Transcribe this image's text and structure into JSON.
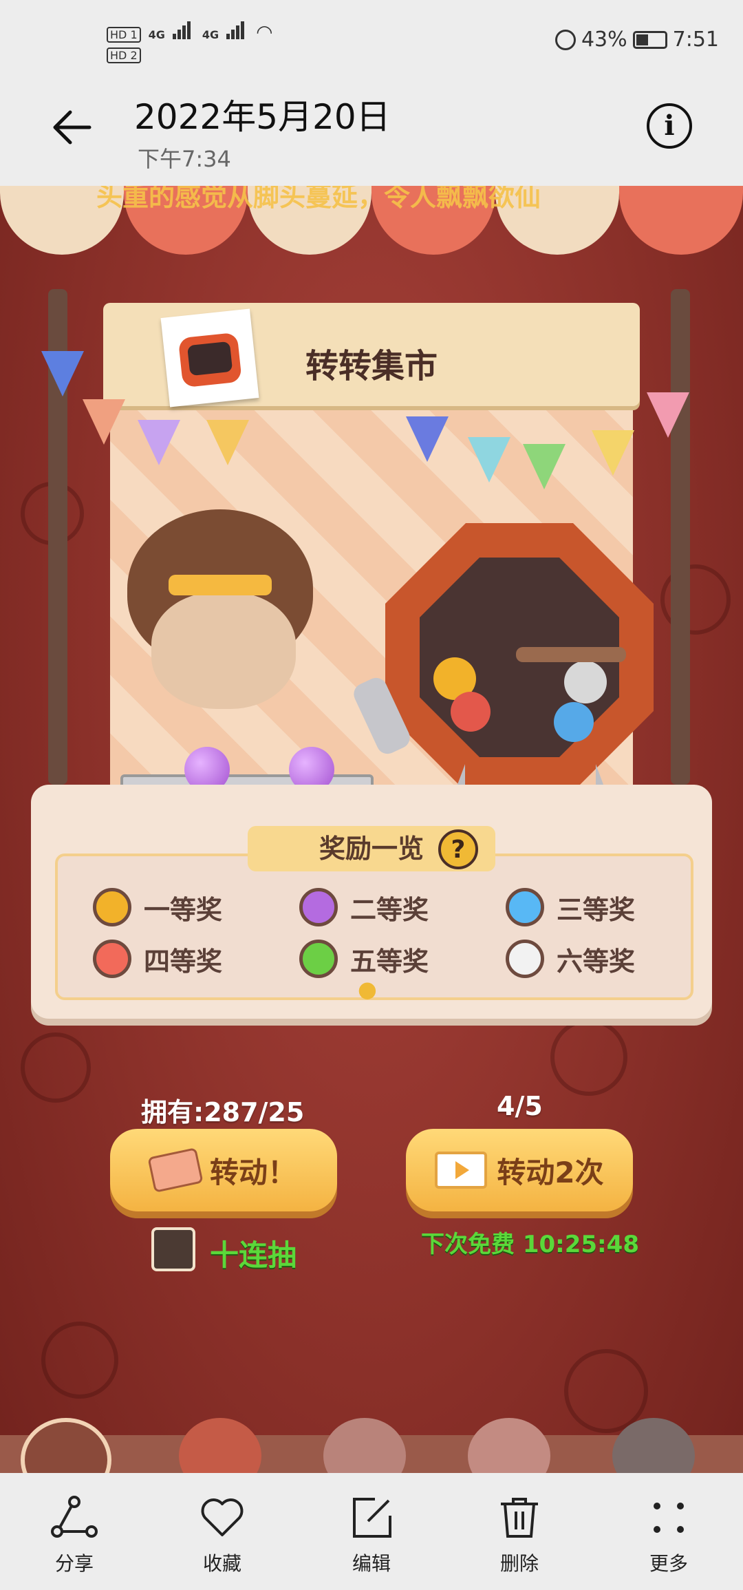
{
  "status_bar": {
    "sim1": "HD 1",
    "sim2": "HD 2",
    "network1": "4G",
    "network2": "4G",
    "battery": "43%",
    "time": "7:51"
  },
  "viewer": {
    "date_title": "2022年5月20日",
    "time_subtitle": "下午7:34",
    "back_icon": "arrow-left-icon",
    "info_icon": "info-icon"
  },
  "game": {
    "banner_text": "头重的感觉从脚头蔓延，令人飘飘欲仙",
    "sign_title": "转转集市",
    "reward_title": "奖励一览",
    "prizes": [
      {
        "label": "一等奖",
        "color": "#f2b22a"
      },
      {
        "label": "二等奖",
        "color": "#b46be0"
      },
      {
        "label": "三等奖",
        "color": "#58b8f5"
      },
      {
        "label": "四等奖",
        "color": "#f26a5a"
      },
      {
        "label": "五等奖",
        "color": "#6ccf45"
      },
      {
        "label": "六等奖",
        "color": "#f2f2f2"
      }
    ],
    "owned_label": "拥有:287/25",
    "spin_count": "4/5",
    "spin_button": "转动！",
    "spin_twice_button": "转动2次",
    "ten_draw_label": "十连抽",
    "free_timer": "下次免费 10:25:48"
  },
  "toolbar": {
    "items": [
      {
        "label": "分享",
        "icon": "share-icon"
      },
      {
        "label": "收藏",
        "icon": "heart-icon"
      },
      {
        "label": "编辑",
        "icon": "edit-icon"
      },
      {
        "label": "删除",
        "icon": "trash-icon"
      },
      {
        "label": "更多",
        "icon": "more-icon"
      }
    ]
  }
}
